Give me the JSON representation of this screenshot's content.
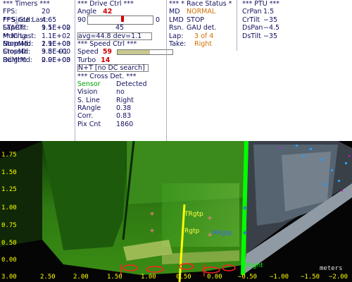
{
  "timers": {
    "header": "*** Timers ***",
    "rows": [
      {
        "k": "FPS:",
        "v": "20"
      },
      {
        "k": "FPS_GUI:",
        "v": "4.65"
      },
      {
        "k": "START:",
        "v": "1.1E+02"
      }
    ],
    "since_header": "** Since Last:",
    "since_rows": [
      {
        "k": "LapCnt:",
        "v": "9.5E+00"
      },
      {
        "k": "MdChg:",
        "v": "1.1E+02"
      },
      {
        "k": "StopMd:",
        "v": "1.1E+00"
      },
      {
        "k": "CrossD:",
        "v": "3.8E-01"
      },
      {
        "k": "DLight:",
        "v": "2.9E+03"
      }
    ],
    "in_header": "** In Last:",
    "in_rows": [
      {
        "k": "NormMd:",
        "v": "2.9E+03"
      },
      {
        "k": "StopMd:",
        "v": "9.5E+00"
      },
      {
        "k": "RdMtMd:",
        "v": "0.0E+00"
      }
    ]
  },
  "drive": {
    "header": "***  Drive Ctrl  ***",
    "angle_label": "Angle",
    "angle_value": "42",
    "slider_min": "90",
    "slider_max": "0",
    "slider_level": 0.53,
    "slider_mid": "45",
    "avg_text": "avg=44.8  dev=1.1",
    "speed_header": "***  Speed Ctrl  ***",
    "speed_label": "Speed",
    "speed_value": "59",
    "speed_bar_fill": 0.59,
    "turbo_label": "Turbo",
    "turbo_value": "14",
    "nt_text": "N+T [no DC search]",
    "cross_header": "*** Cross Det. ***",
    "sensor_label": "Sensor",
    "detected_label": "Detected",
    "cross_rows": [
      {
        "k": "Vision",
        "v": "no"
      },
      {
        "k": "S. Line",
        "v": "Right"
      },
      {
        "k": "RAngle",
        "v": "0.38"
      },
      {
        "k": "Corr.",
        "v": "0.83"
      },
      {
        "k": "Pix Cnt",
        "v": "1860"
      }
    ]
  },
  "race": {
    "header": "* Race Status *",
    "md_label": "MD",
    "md_value": "NORMAL",
    "lmd_label": "LMD",
    "lmd_value": "STOP",
    "rsn_label": "Rsn.",
    "rsn_value": "GAU det.",
    "lap_label": "Lap:",
    "lap_value": "3 of 4",
    "take_label": "Take:",
    "take_value": "Right"
  },
  "ptu": {
    "header": "*** PTU ***",
    "rows": [
      {
        "k": "CrPan",
        "v": "1.5"
      },
      {
        "k": "CrTilt",
        "v": "−35"
      },
      {
        "k": "DsPan",
        "v": "−4.5"
      },
      {
        "k": "DsTilt",
        "v": "−35"
      }
    ]
  },
  "camera": {
    "y_ticks": [
      "1.75",
      "1.50",
      "1.25",
      "1.00",
      "0.75",
      "0.50"
    ],
    "x_ticks": [
      "3.00",
      "2.50",
      "2.00",
      "1.50",
      "1.00",
      "0.50",
      "0.00",
      "−0.50",
      "−1.00",
      "−1.50",
      "−2.00"
    ],
    "units": "meters",
    "left_tick": "0.00",
    "labels": {
      "trgtp": "TRgtp",
      "rgtp": "Rgtp",
      "rrgtp": "RRgtp",
      "right": "Right"
    },
    "colors": {
      "track_green": "#2a8a10",
      "lane_yellow": "#ffff00",
      "tape_green": "#00ff00",
      "marker": "#ff2020"
    }
  }
}
